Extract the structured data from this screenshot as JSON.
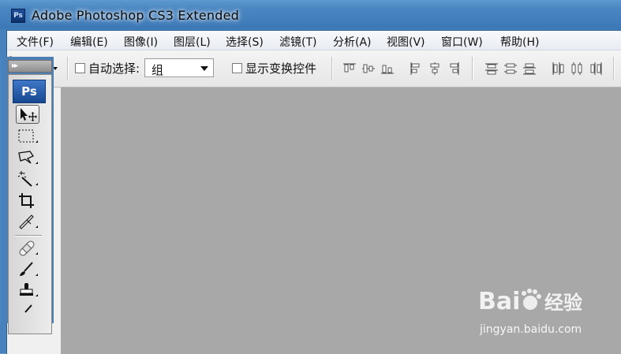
{
  "window": {
    "title": "Adobe Photoshop CS3 Extended",
    "app_icon": "Ps"
  },
  "menu": [
    "文件(F)",
    "编辑(E)",
    "图像(I)",
    "图层(L)",
    "选择(S)",
    "滤镜(T)",
    "分析(A)",
    "视图(V)",
    "窗口(W)",
    "帮助(H)"
  ],
  "options": {
    "auto_select_label": "自动选择:",
    "auto_select_value": "组",
    "show_transform_label": "显示变换控件"
  },
  "toolbox": {
    "logo": "Ps",
    "tools": [
      "move-tool",
      "marquee-tool",
      "lasso-tool",
      "magic-wand-tool",
      "crop-tool",
      "slice-tool",
      "healing-brush-tool",
      "brush-tool",
      "clone-stamp-tool"
    ]
  },
  "watermark": {
    "logo_text": "Bai 经验",
    "url": "jingyan.baidu.com"
  }
}
